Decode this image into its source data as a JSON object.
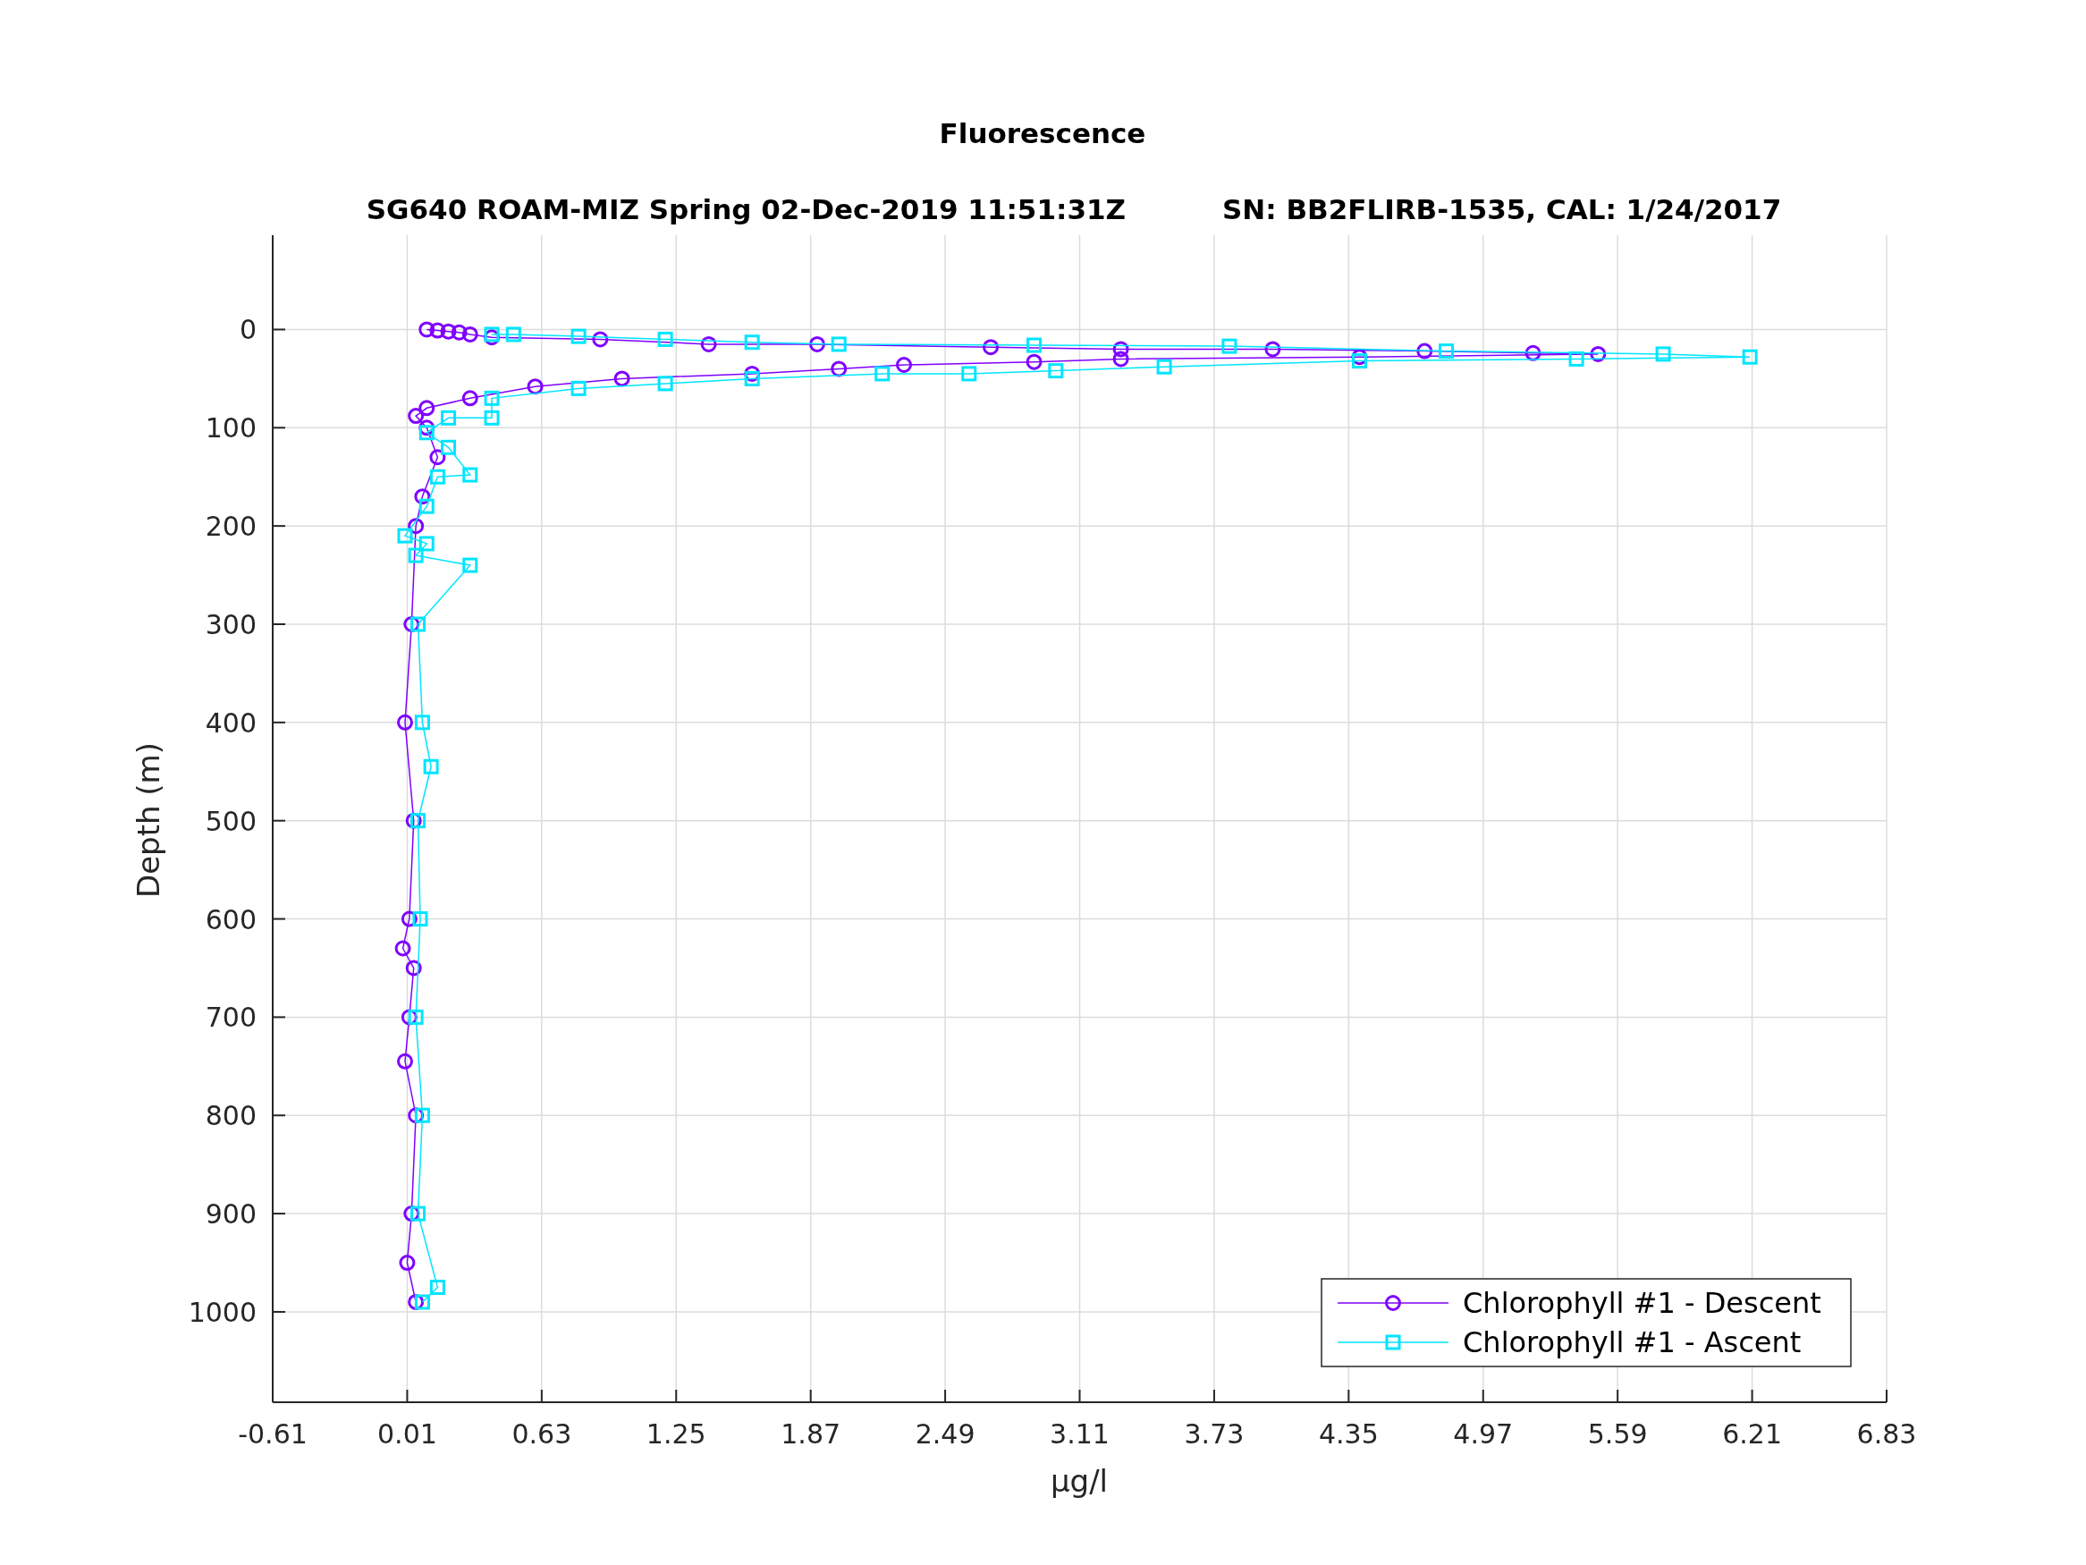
{
  "figure": {
    "title": "Fluorescence",
    "subtitle": "SG640 ROAM-MIZ Spring 02-Dec-2019 11:51:31Z          SN: BB2FLIRB-1535, CAL: 1/24/2017",
    "chart_data": {
      "type": "line",
      "grid": true,
      "legend": true,
      "xlabel": "μg/l",
      "ylabel": "Depth (m)",
      "xlim": [
        -0.61,
        6.83
      ],
      "ylim": [
        1092,
        -96
      ],
      "xticks": [
        {
          "value": -0.61,
          "label": "-0.61"
        },
        {
          "value": 0.01,
          "label": "0.01"
        },
        {
          "value": 0.63,
          "label": "0.63"
        },
        {
          "value": 1.25,
          "label": "1.25"
        },
        {
          "value": 1.87,
          "label": "1.87"
        },
        {
          "value": 2.49,
          "label": "2.49"
        },
        {
          "value": 3.11,
          "label": "3.11"
        },
        {
          "value": 3.73,
          "label": "3.73"
        },
        {
          "value": 4.35,
          "label": "4.35"
        },
        {
          "value": 4.97,
          "label": "4.97"
        },
        {
          "value": 5.59,
          "label": "5.59"
        },
        {
          "value": 6.21,
          "label": "6.21"
        },
        {
          "value": 6.83,
          "label": "6.83"
        }
      ],
      "yticks": [
        {
          "value": 0,
          "label": "0"
        },
        {
          "value": 100,
          "label": "100"
        },
        {
          "value": 200,
          "label": "200"
        },
        {
          "value": 300,
          "label": "300"
        },
        {
          "value": 400,
          "label": "400"
        },
        {
          "value": 500,
          "label": "500"
        },
        {
          "value": 600,
          "label": "600"
        },
        {
          "value": 700,
          "label": "700"
        },
        {
          "value": 800,
          "label": "800"
        },
        {
          "value": 900,
          "label": "900"
        },
        {
          "value": 1000,
          "label": "1000"
        }
      ],
      "series": [
        {
          "name": "Chlorophyll #1 - Descent",
          "color": "#7f00ff",
          "marker": "circle",
          "x": [
            0.1,
            0.15,
            0.2,
            0.25,
            0.3,
            0.4,
            0.9,
            1.4,
            1.9,
            2.7,
            3.3,
            4.0,
            4.7,
            5.2,
            5.5,
            4.4,
            3.3,
            2.9,
            2.3,
            2.0,
            1.6,
            1.0,
            0.6,
            0.3,
            0.1,
            0.05,
            0.1,
            0.15,
            0.08,
            0.05,
            0.03,
            0.0,
            0.04,
            0.02,
            -0.01,
            0.04,
            0.02,
            0.0,
            0.05,
            0.03,
            0.01,
            0.05
          ],
          "values": [
            0,
            1,
            2,
            3,
            5,
            8,
            10,
            15,
            15,
            18,
            20,
            20,
            22,
            24,
            25,
            28,
            30,
            33,
            36,
            40,
            45,
            50,
            58,
            70,
            80,
            88,
            100,
            130,
            170,
            200,
            300,
            400,
            500,
            600,
            630,
            650,
            700,
            745,
            800,
            900,
            950,
            990
          ]
        },
        {
          "name": "Chlorophyll #1 - Ascent",
          "color": "#00e5ff",
          "marker": "square",
          "x": [
            0.08,
            0.15,
            0.06,
            0.08,
            0.05,
            0.07,
            0.06,
            0.12,
            0.08,
            0.06,
            0.3,
            0.05,
            0.1,
            0.0,
            0.1,
            0.15,
            0.3,
            0.2,
            0.1,
            0.2,
            0.4,
            0.4,
            0.8,
            1.2,
            1.6,
            2.2,
            2.6,
            3.0,
            3.5,
            4.4,
            5.4,
            6.2,
            5.8,
            4.8,
            3.8,
            2.9,
            2.0,
            1.6,
            1.2,
            0.8,
            0.5,
            0.4
          ],
          "values": [
            990,
            975,
            900,
            800,
            700,
            600,
            500,
            445,
            400,
            300,
            240,
            230,
            218,
            210,
            180,
            150,
            148,
            120,
            105,
            90,
            90,
            70,
            60,
            55,
            50,
            45,
            45,
            42,
            38,
            32,
            30,
            28,
            25,
            22,
            17,
            16,
            15,
            13,
            10,
            7,
            5,
            5
          ]
        }
      ]
    }
  }
}
